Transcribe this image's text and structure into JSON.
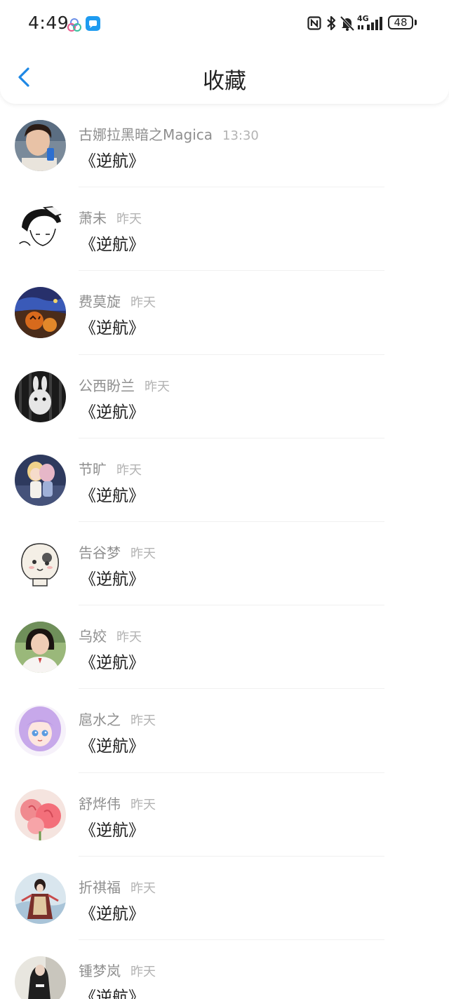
{
  "status_bar": {
    "time": "4:49",
    "network": "4G",
    "battery": "48",
    "icons": [
      "multicolor-app-icon",
      "chat-app-icon",
      "nfc-icon",
      "bluetooth-icon",
      "mute-bell-icon",
      "signal-icon",
      "battery-icon"
    ]
  },
  "header": {
    "title": "收藏",
    "back_icon": "chevron-left-icon"
  },
  "colors": {
    "accent": "#1e88e5",
    "name_text": "#8f8f8f",
    "time_text": "#b3b3b3",
    "message_text": "#1e1e1e"
  },
  "items": [
    {
      "name": "古娜拉黑暗之Magica",
      "time": "13:30",
      "message": "《逆航》"
    },
    {
      "name": "萧未",
      "time": "昨天",
      "message": "《逆航》"
    },
    {
      "name": "费莫旋",
      "time": "昨天",
      "message": "《逆航》"
    },
    {
      "name": "公西盼兰",
      "time": "昨天",
      "message": "《逆航》"
    },
    {
      "name": "节旷",
      "time": "昨天",
      "message": "《逆航》"
    },
    {
      "name": "告谷梦",
      "time": "昨天",
      "message": "《逆航》"
    },
    {
      "name": "乌姣",
      "time": "昨天",
      "message": "《逆航》"
    },
    {
      "name": "扈水之",
      "time": "昨天",
      "message": "《逆航》"
    },
    {
      "name": "舒烨伟",
      "time": "昨天",
      "message": "《逆航》"
    },
    {
      "name": "折祺福",
      "time": "昨天",
      "message": "《逆航》"
    },
    {
      "name": "锺梦岚",
      "time": "昨天",
      "message": "《逆航》"
    }
  ]
}
